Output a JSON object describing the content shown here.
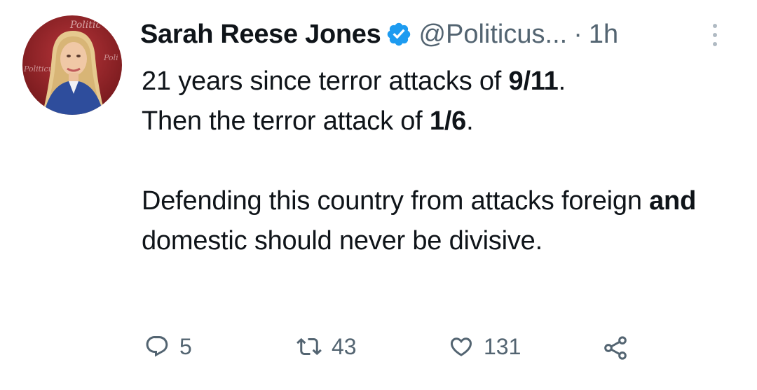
{
  "tweet": {
    "author_name": "Sarah Reese Jones",
    "handle": "@Politicus...",
    "separator": "·",
    "time": "1h",
    "verified_color": "#1d9bf0",
    "body": {
      "line1_pre": "21 years since terror attacks of ",
      "line1_bold": "9/11",
      "line1_post": ".",
      "line2_pre": "Then the terror attack of ",
      "line2_bold": "1/6",
      "line2_post": ".",
      "para2_pre": "Defending this country from attacks foreign ",
      "para2_bold": "and",
      "para2_post": " domestic should never be divisive."
    },
    "actions": {
      "reply_count": "5",
      "retweet_count": "43",
      "like_count": "131"
    },
    "icon_color": "#536471"
  }
}
